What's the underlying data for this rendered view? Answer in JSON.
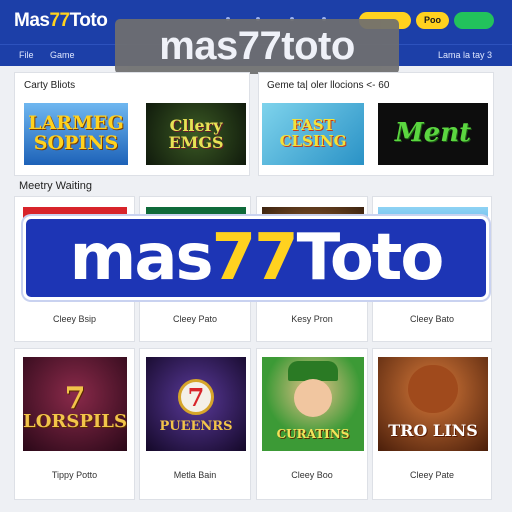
{
  "header": {
    "logo_prefix": "Mas",
    "logo_highlight": "77",
    "logo_suffix": "Toto",
    "pills": [
      "",
      "Poo",
      ""
    ]
  },
  "nav": {
    "items": [
      "File",
      "Game",
      "Lama la tay 3"
    ]
  },
  "overlay": {
    "banner_text": "mas77toto",
    "big_prefix": "mas",
    "big_highlight": "77",
    "big_suffix": "Toto"
  },
  "sections": {
    "featured_left": "Carty Bliots",
    "featured_right": "Geme ta| oler llocions <- 60",
    "waiting": "Meetry Waiting"
  },
  "featured": [
    {
      "art_text": "LARMEG SOPINS",
      "bg": "#2b7ad1",
      "fg": "#ffd21f"
    },
    {
      "art_text": "Cllery EMGS",
      "bg": "#1a2a18",
      "fg": "#e7e255"
    },
    {
      "art_text": "FAST CLSING",
      "bg": "#35b5d8",
      "fg": "#f2e23a"
    },
    {
      "art_text": "Ment",
      "bg": "#0d0d0d",
      "fg": "#5bd640"
    }
  ],
  "grid_row1": [
    {
      "caption": "Cleey Bsip",
      "bg": "#d8242a"
    },
    {
      "caption": "Cleey Pato",
      "bg": "#0f6a3a"
    },
    {
      "caption": "Kesy Pron",
      "bg": "#5c3a1c"
    },
    {
      "caption": "Cleey Bato",
      "bg": "#3c8fe0"
    }
  ],
  "grid_row2": [
    {
      "caption": "Tippy Potto",
      "art_text": "LORSPILS",
      "bg": "#4a0f2a",
      "fg": "#f2c44a"
    },
    {
      "caption": "Metla Bain",
      "art_text": "PUEENRS",
      "bg": "#2a1450",
      "fg": "#f2c44a"
    },
    {
      "caption": "Cleey Boo",
      "art_text": "CURATINS",
      "bg": "#3c9a36",
      "fg": "#f4e35a"
    },
    {
      "caption": "Cleey Pate",
      "art_text": "TRO LINS",
      "bg": "#7b3a18",
      "fg": "#f0b42a"
    }
  ],
  "colors": {
    "header_blue": "#1c3fa8",
    "accent_yellow": "#ffd21f",
    "accent_green": "#22c25c",
    "banner_blue": "#1d35b5"
  }
}
